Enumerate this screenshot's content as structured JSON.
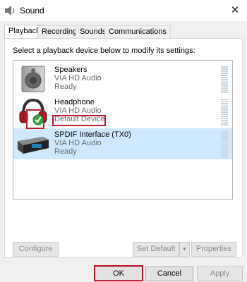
{
  "window": {
    "title": "Sound",
    "close_glyph": "✕"
  },
  "tabs": [
    {
      "label": "Playback",
      "active": true
    },
    {
      "label": "Recording",
      "active": false
    },
    {
      "label": "Sounds",
      "active": false
    },
    {
      "label": "Communications",
      "active": false
    }
  ],
  "instruction": "Select a playback device below to modify its settings:",
  "devices": [
    {
      "name": "Speakers",
      "driver": "VIA HD Audio",
      "status": "Ready",
      "icon": "speaker-icon"
    },
    {
      "name": "Headphone",
      "driver": "VIA HD Audio",
      "status": "Default Device",
      "icon": "headphone-icon",
      "default": true
    },
    {
      "name": "SPDIF Interface (TX0)",
      "driver": "VIA HD Audio",
      "status": "Ready",
      "icon": "spdif-icon",
      "selected": true
    }
  ],
  "buttons": {
    "configure": "Configure",
    "set_default": "Set Default",
    "properties": "Properties",
    "ok": "OK",
    "cancel": "Cancel",
    "apply": "Apply"
  },
  "colors": {
    "highlight": "#c2182b",
    "selection": "#cde8ff",
    "check_green": "#3aa640"
  }
}
